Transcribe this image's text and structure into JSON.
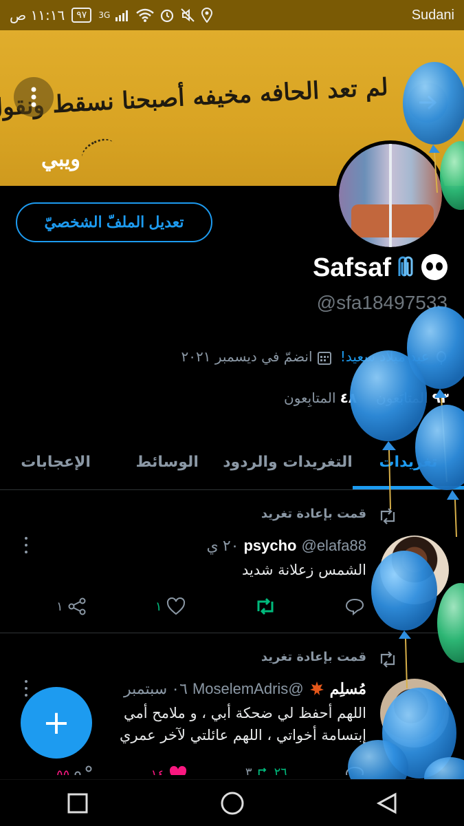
{
  "status_bar": {
    "time": "١١:١٦ ص",
    "battery": "٩٧",
    "network": "3G",
    "carrier": "Sudani"
  },
  "banner": {
    "text": "لم تعد الحافه مخيفه أصبحنا نسقط ونقول",
    "signature": "ويبي"
  },
  "profile": {
    "edit_button": "تعديل الملفّ الشخصيّ",
    "display_name": "Safsaf",
    "handle": "@sfa18497533",
    "birthday": "عيد ميلاد سعيد!",
    "joined": "انضمّ في ديسمبر ٢٠٢١",
    "followers_count": "٤٨",
    "followers_label": "المتابِعون",
    "following_count": "٩٣",
    "following_label": "المتابَعون"
  },
  "tabs": [
    {
      "label": "تغريدات",
      "active": true
    },
    {
      "label": "التغريدات والردود",
      "active": false
    },
    {
      "label": "الوسائط",
      "active": false
    },
    {
      "label": "الإعجابات",
      "active": false
    }
  ],
  "tweets": [
    {
      "retweet_label": "قمت بإعادة تغريد",
      "display_name": "psycho",
      "handle": "@elafa88",
      "time": "٢٠ ي",
      "body": "الشمس زعلانة شديد",
      "replies": "",
      "retweets": "",
      "likes": "١",
      "shares": "١"
    },
    {
      "retweet_label": "قمت بإعادة تغريد",
      "display_name": "مُسلِم",
      "handle": "@MoselemAdris",
      "time": "٠٦ سبتمبر",
      "body_line1": "اللهم أحفظ  لي ضحكة أبي ، و ملامح أمي",
      "body_line2": "إبتسامة أخواتي ، اللهم عائلتي لآخر عمري",
      "retweets": "٢٦",
      "replies_count": "٣",
      "likes": "١٤",
      "shares": "٥٥"
    }
  ],
  "fab": {
    "label": "+"
  },
  "colors": {
    "accent": "#1d9bf0",
    "retweet_green": "#00ba7c",
    "status_bar": "#7a5a05",
    "banner": "#d9a423"
  },
  "icons": [
    "more-vert-icon",
    "back-arrow-icon",
    "balloon-icon",
    "calendar-icon",
    "retweet-icon",
    "reply-icon",
    "like-icon",
    "share-icon",
    "plus-icon",
    "square-nav-icon",
    "circle-nav-icon",
    "triangle-nav-icon"
  ]
}
